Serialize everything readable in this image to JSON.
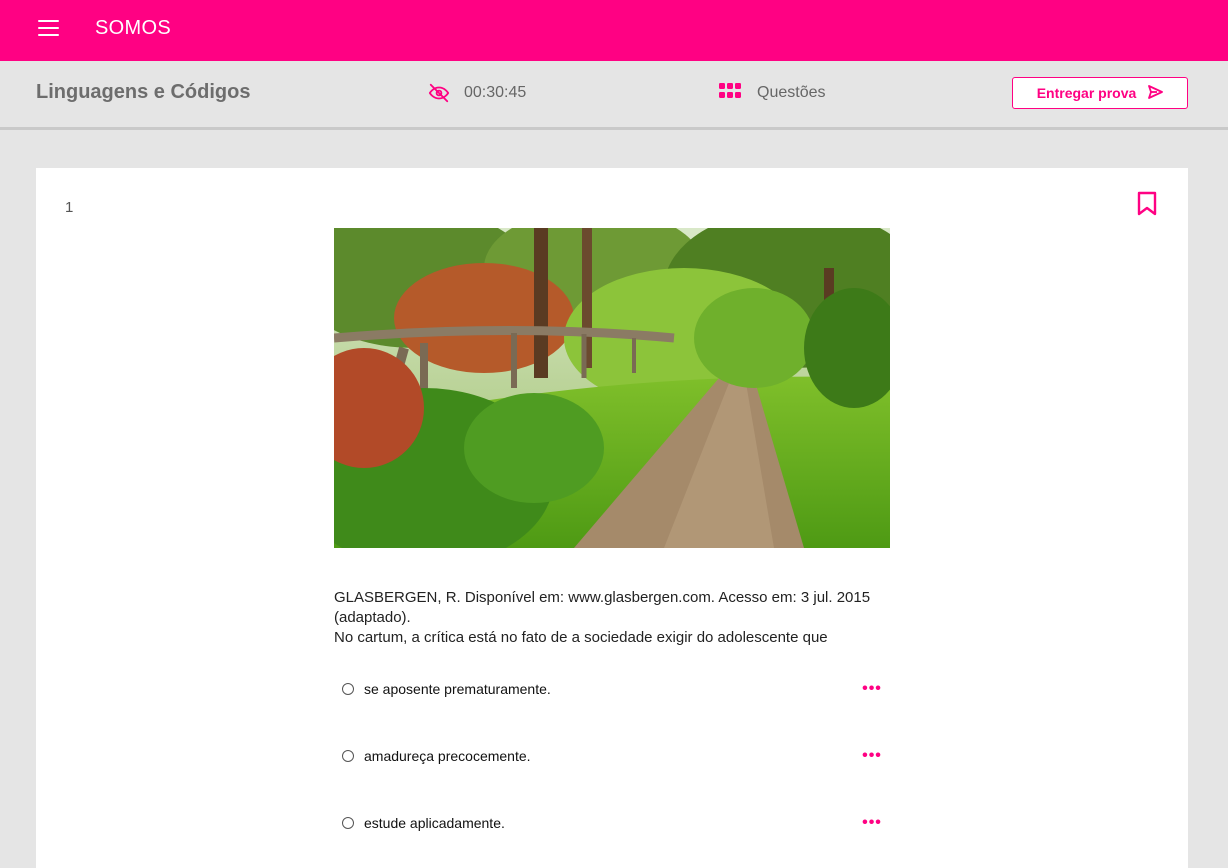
{
  "app": {
    "brand": "SOMOS",
    "accent_color": "#ff0183"
  },
  "header": {
    "subject": "Linguagens e Códigos",
    "timer": "00:30:45",
    "timer_icon": "eye-off-icon",
    "questions_label": "Questões",
    "questions_icon": "grid-icon",
    "submit_label": "Entregar prova",
    "submit_icon": "send-icon"
  },
  "question": {
    "number": "1",
    "bookmark_icon": "bookmark-icon",
    "source_text": "GLASBERGEN, R. Disponível em: www.glasbergen.com. Acesso em: 3 jul. 2015 (adaptado).",
    "prompt": "No cartum, a crítica está no fato de a sociedade exigir do adolescente que",
    "options": [
      {
        "text": "se aposente prematuramente."
      },
      {
        "text": "amadureça precocemente."
      },
      {
        "text": "estude aplicadamente."
      }
    ],
    "more_icon": "more-horizontal-icon"
  }
}
